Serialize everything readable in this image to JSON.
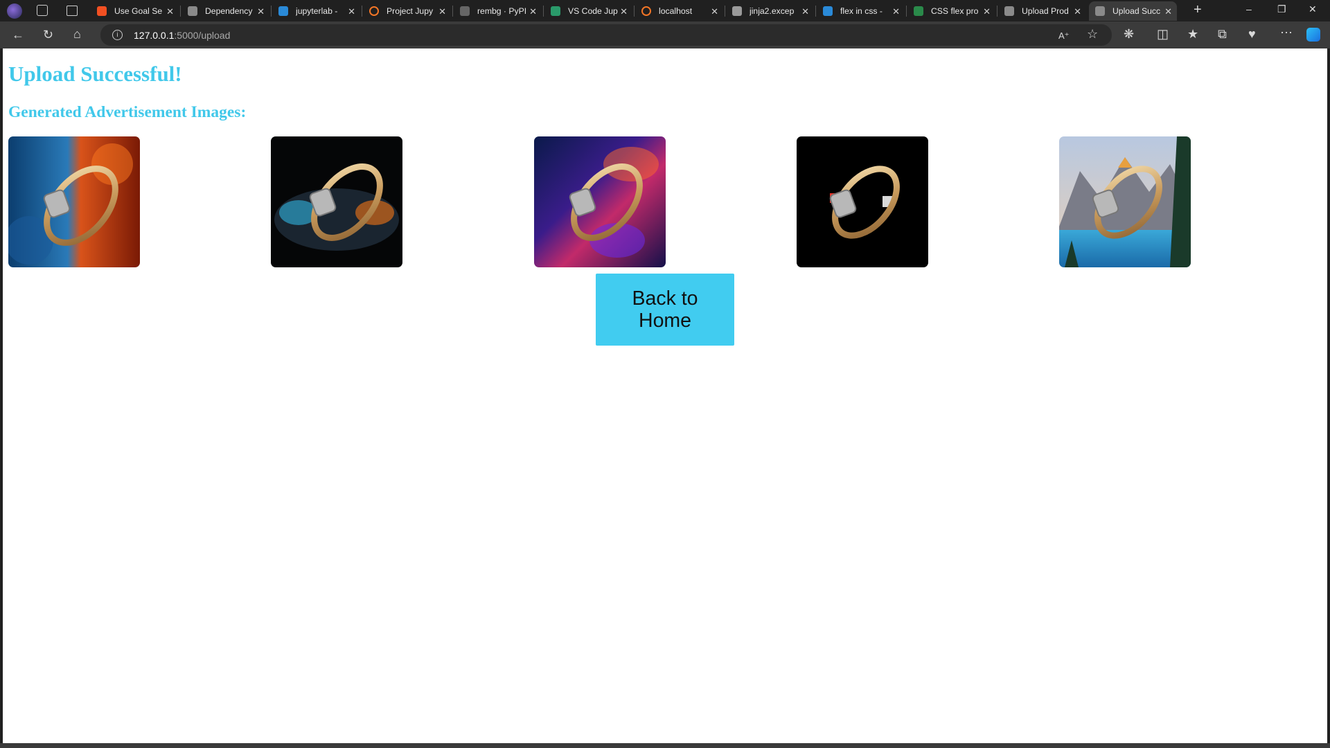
{
  "browser": {
    "tabs": [
      {
        "title": "Use Goal Se",
        "favicon": "microsoft-icon"
      },
      {
        "title": "Dependency",
        "favicon": "page-icon"
      },
      {
        "title": "jupyterlab -",
        "favicon": "bing-icon"
      },
      {
        "title": "Project Jupy",
        "favicon": "jupyter-icon"
      },
      {
        "title": "rembg · PyPI",
        "favicon": "pypi-icon"
      },
      {
        "title": "VS Code Jup",
        "favicon": "vscode-icon"
      },
      {
        "title": "localhost",
        "favicon": "jupyter-icon"
      },
      {
        "title": "jinja2.excep",
        "favicon": "terminal-icon"
      },
      {
        "title": "flex in css -",
        "favicon": "bing-icon"
      },
      {
        "title": "CSS flex pro",
        "favicon": "w3schools-icon"
      },
      {
        "title": "Upload Prod",
        "favicon": "page-icon"
      },
      {
        "title": "Upload Succ",
        "favicon": "page-icon"
      }
    ],
    "url_host": "127.0.0.1",
    "url_rest": ":5000/upload"
  },
  "page": {
    "heading": "Upload Successful!",
    "subheading": "Generated Advertisement Images:",
    "images": [
      {
        "alt": "ring-on-fire-ice-background"
      },
      {
        "alt": "ring-on-sports-car-background"
      },
      {
        "alt": "ring-on-cosmic-nebula-background"
      },
      {
        "alt": "ring-on-black-logo-background"
      },
      {
        "alt": "ring-on-mountain-lake-background"
      }
    ],
    "back_button": "Back to Home"
  },
  "colors": {
    "accent": "#41c8ea",
    "button": "#41ccf0",
    "browser_chrome": "#202020",
    "toolbar": "#3b3b3b"
  }
}
